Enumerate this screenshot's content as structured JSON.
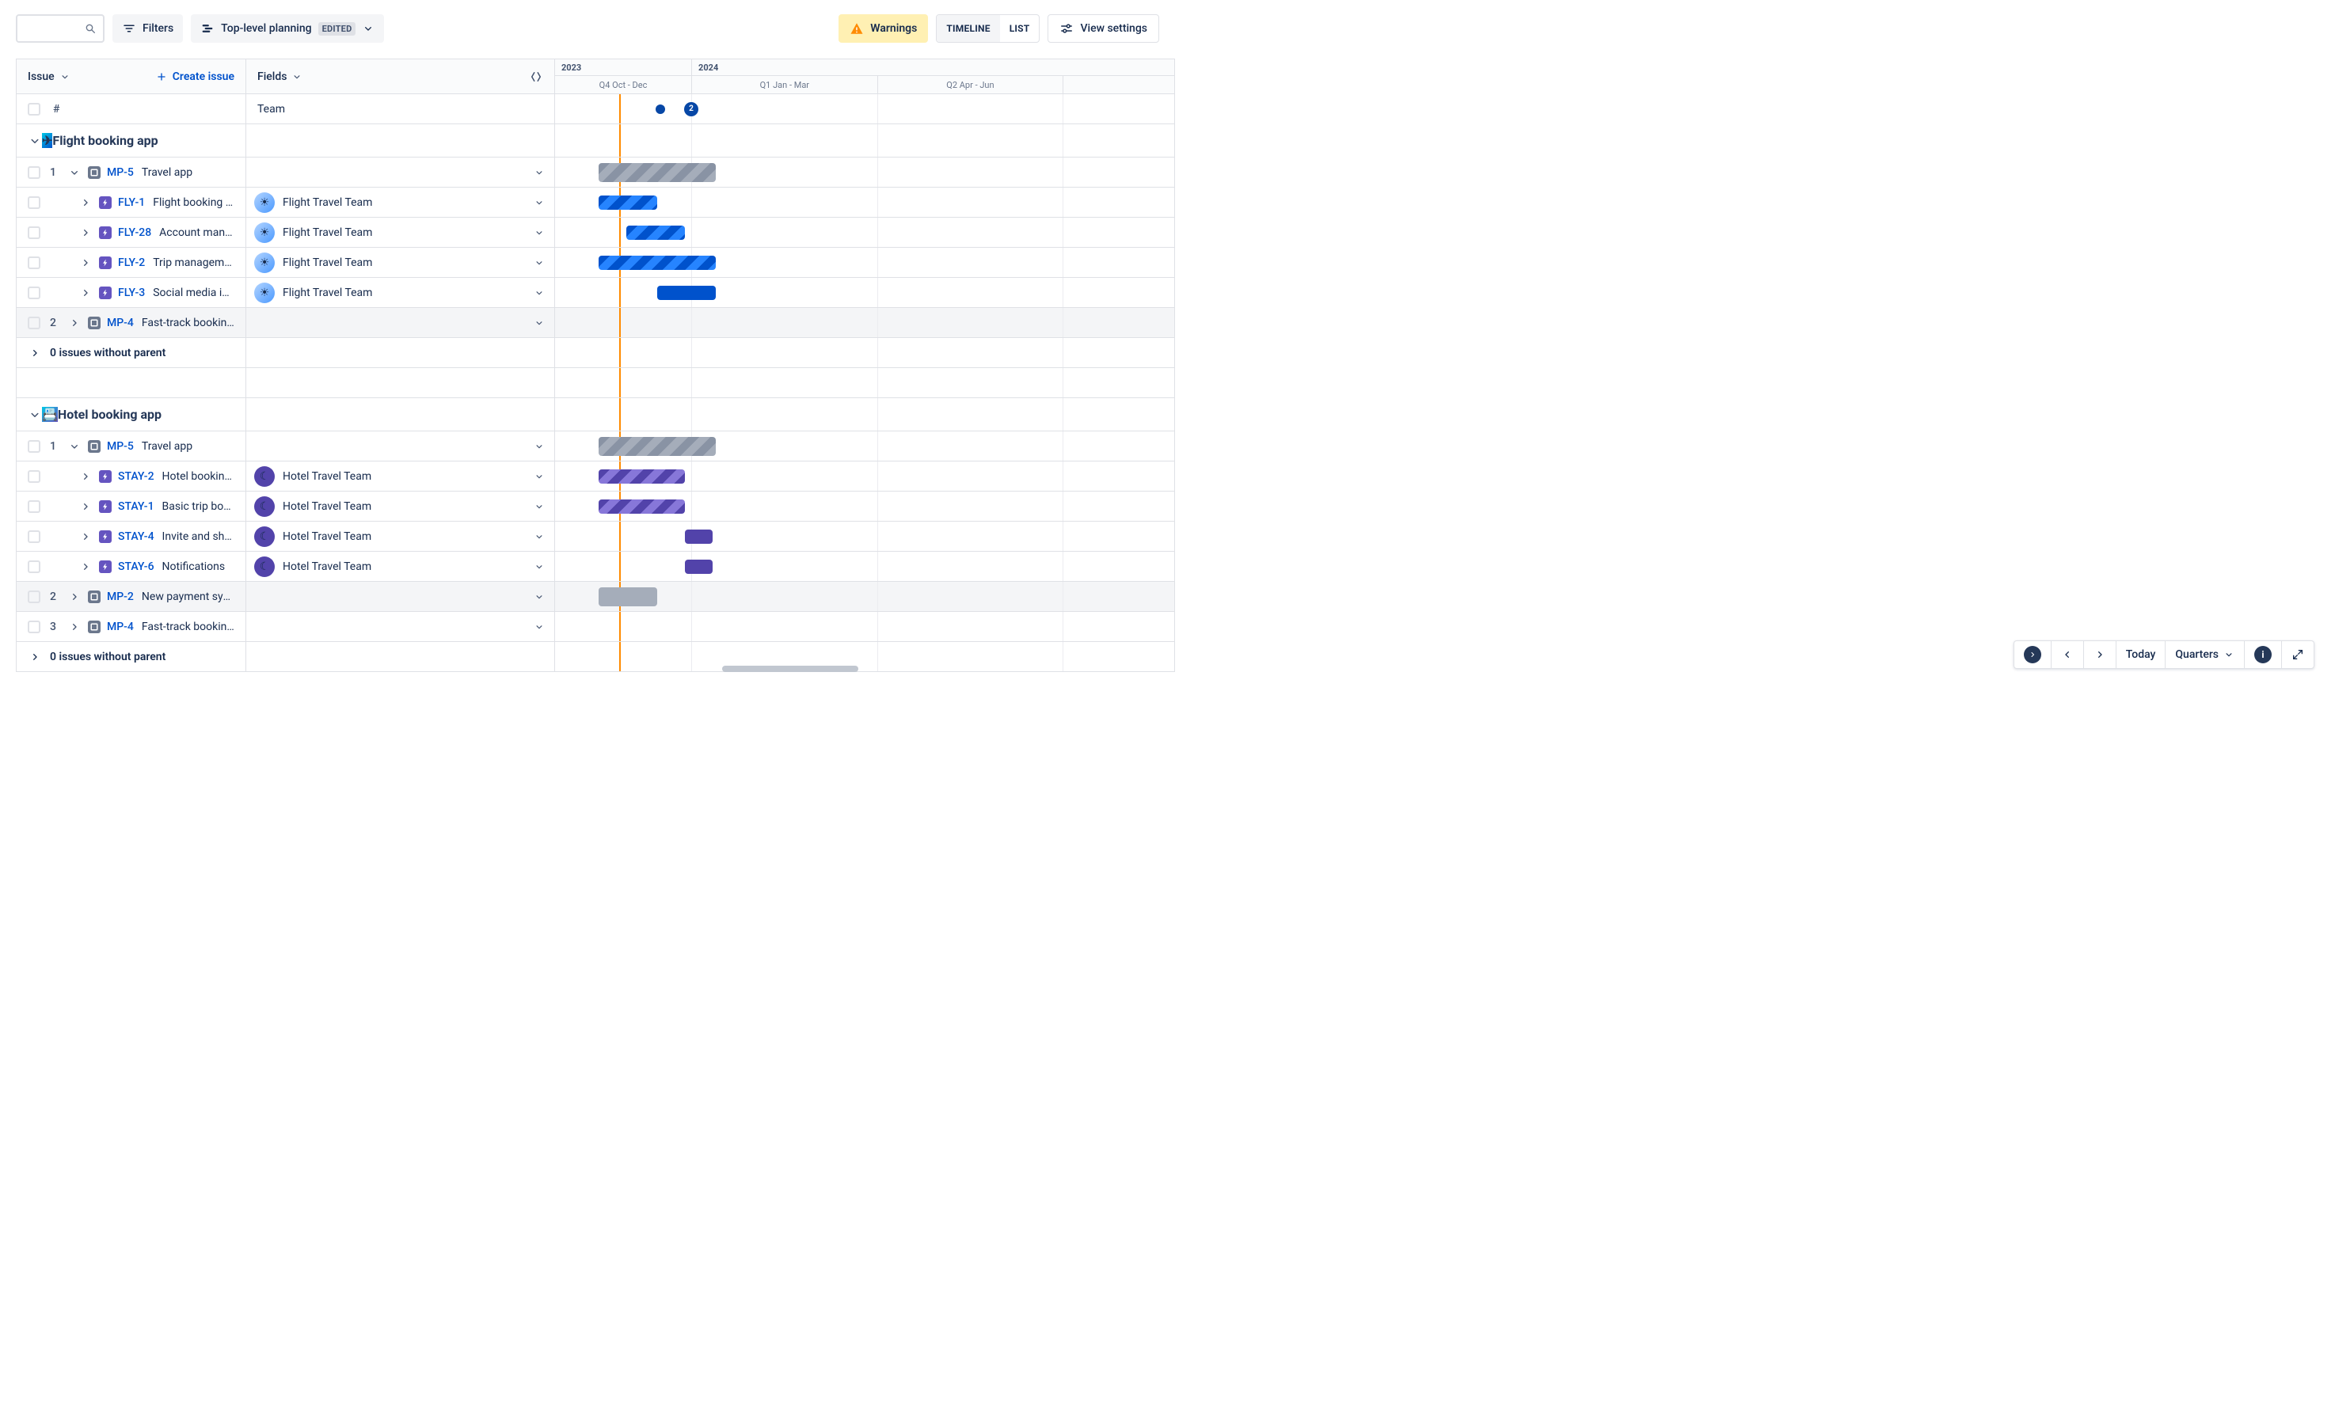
{
  "toolbar": {
    "filters_label": "Filters",
    "plan_name": "Top-level planning",
    "edited_badge": "EDITED",
    "warnings_label": "Warnings",
    "toggle_timeline": "TIMELINE",
    "toggle_list": "LIST",
    "active_toggle": "TIMELINE",
    "view_settings_label": "View settings"
  },
  "columns": {
    "issue_header": "Issue",
    "create_issue_label": "Create issue",
    "fields_header": "Fields",
    "hash_header": "#",
    "team_header": "Team"
  },
  "timeline": {
    "years": [
      {
        "label": "2023",
        "width_pct": 22
      },
      {
        "label": "2024",
        "width_pct": 78
      }
    ],
    "quarters": [
      {
        "label": "Q4 Oct - Dec",
        "left_pct": 0,
        "width_pct": 22
      },
      {
        "label": "Q1 Jan - Mar",
        "left_pct": 22,
        "width_pct": 30
      },
      {
        "label": "Q2 Apr - Jun",
        "left_pct": 52,
        "width_pct": 30
      },
      {
        "label": "",
        "left_pct": 82,
        "width_pct": 18
      }
    ],
    "quarter_lines_pct": [
      22,
      52,
      82
    ],
    "today_pct": 10.3,
    "markers": [
      {
        "type": "dot",
        "left_pct": 17.0
      },
      {
        "type": "badge",
        "left_pct": 22.0,
        "label": "2"
      }
    ]
  },
  "bottom_controls": {
    "today_label": "Today",
    "scale_label": "Quarters"
  },
  "sections": [
    {
      "title": "Flight booking app",
      "icon_bg": "linear-gradient(135deg,#00C7E6,#0052CC)",
      "icon_glyph": "✈",
      "rows": [
        {
          "type": "init",
          "idx": "1",
          "expanded": true,
          "key": "MP-5",
          "summary": "Travel app",
          "highlight": false,
          "team": null,
          "bar": {
            "style": "gray",
            "left_pct": 7,
            "width_pct": 19
          }
        },
        {
          "type": "epic",
          "key": "FLY-1",
          "summary": "Flight booking a...",
          "highlight": false,
          "team": {
            "name": "Flight Travel Team",
            "avatar": "flight",
            "glyph": "☀"
          },
          "bar": {
            "style": "blue",
            "left_pct": 7,
            "width_pct": 9.5
          }
        },
        {
          "type": "epic",
          "key": "FLY-28",
          "summary": "Account mana...",
          "highlight": false,
          "team": {
            "name": "Flight Travel Team",
            "avatar": "flight",
            "glyph": "☀"
          },
          "bar": {
            "style": "blue",
            "left_pct": 11.5,
            "width_pct": 9.5
          }
        },
        {
          "type": "epic",
          "key": "FLY-2",
          "summary": "Trip management",
          "highlight": false,
          "team": {
            "name": "Flight Travel Team",
            "avatar": "flight",
            "glyph": "☀"
          },
          "bar": {
            "style": "blue",
            "left_pct": 7,
            "width_pct": 19
          }
        },
        {
          "type": "epic",
          "key": "FLY-3",
          "summary": "Social media int...",
          "highlight": false,
          "team": {
            "name": "Flight Travel Team",
            "avatar": "flight",
            "glyph": "☀"
          },
          "bar": {
            "style": "blue-solid",
            "left_pct": 16.5,
            "width_pct": 9.5
          }
        },
        {
          "type": "init",
          "idx": "2",
          "expanded": false,
          "key": "MP-4",
          "summary": "Fast-track booking ...",
          "highlight": true,
          "team": null,
          "bar": null
        }
      ],
      "orphans_label": "0 issues without parent"
    },
    {
      "title": "Hotel booking app",
      "icon_bg": "linear-gradient(135deg,#00C7E6,#6554C0)",
      "icon_glyph": "📇",
      "rows": [
        {
          "type": "init",
          "idx": "1",
          "expanded": true,
          "key": "MP-5",
          "summary": "Travel app",
          "highlight": false,
          "team": null,
          "bar": {
            "style": "gray",
            "left_pct": 7,
            "width_pct": 19
          }
        },
        {
          "type": "epic",
          "key": "STAY-2",
          "summary": "Hotel booking ...",
          "highlight": false,
          "team": {
            "name": "Hotel Travel Team",
            "avatar": "hotel",
            "glyph": "☾"
          },
          "bar": {
            "style": "purple",
            "left_pct": 7,
            "width_pct": 14
          }
        },
        {
          "type": "epic",
          "key": "STAY-1",
          "summary": "Basic trip book...",
          "highlight": false,
          "team": {
            "name": "Hotel Travel Team",
            "avatar": "hotel",
            "glyph": "☾"
          },
          "bar": {
            "style": "purple",
            "left_pct": 7,
            "width_pct": 14
          }
        },
        {
          "type": "epic",
          "key": "STAY-4",
          "summary": "Invite and share",
          "highlight": false,
          "team": {
            "name": "Hotel Travel Team",
            "avatar": "hotel",
            "glyph": "☾"
          },
          "bar": {
            "style": "purple-solid",
            "left_pct": 21,
            "width_pct": 4.5
          }
        },
        {
          "type": "epic",
          "key": "STAY-6",
          "summary": "Notifications",
          "highlight": false,
          "team": {
            "name": "Hotel Travel Team",
            "avatar": "hotel",
            "glyph": "☾"
          },
          "bar": {
            "style": "purple-solid",
            "left_pct": 21,
            "width_pct": 4.5
          }
        },
        {
          "type": "init",
          "idx": "2",
          "expanded": false,
          "key": "MP-2",
          "summary": "New payment system",
          "highlight": true,
          "team": null,
          "bar": {
            "style": "gray-solid",
            "left_pct": 7,
            "width_pct": 9.5
          }
        },
        {
          "type": "init",
          "idx": "3",
          "expanded": false,
          "key": "MP-4",
          "summary": "Fast-track booking ...",
          "highlight": false,
          "team": null,
          "bar": null
        }
      ],
      "orphans_label": "0 issues without parent"
    }
  ]
}
